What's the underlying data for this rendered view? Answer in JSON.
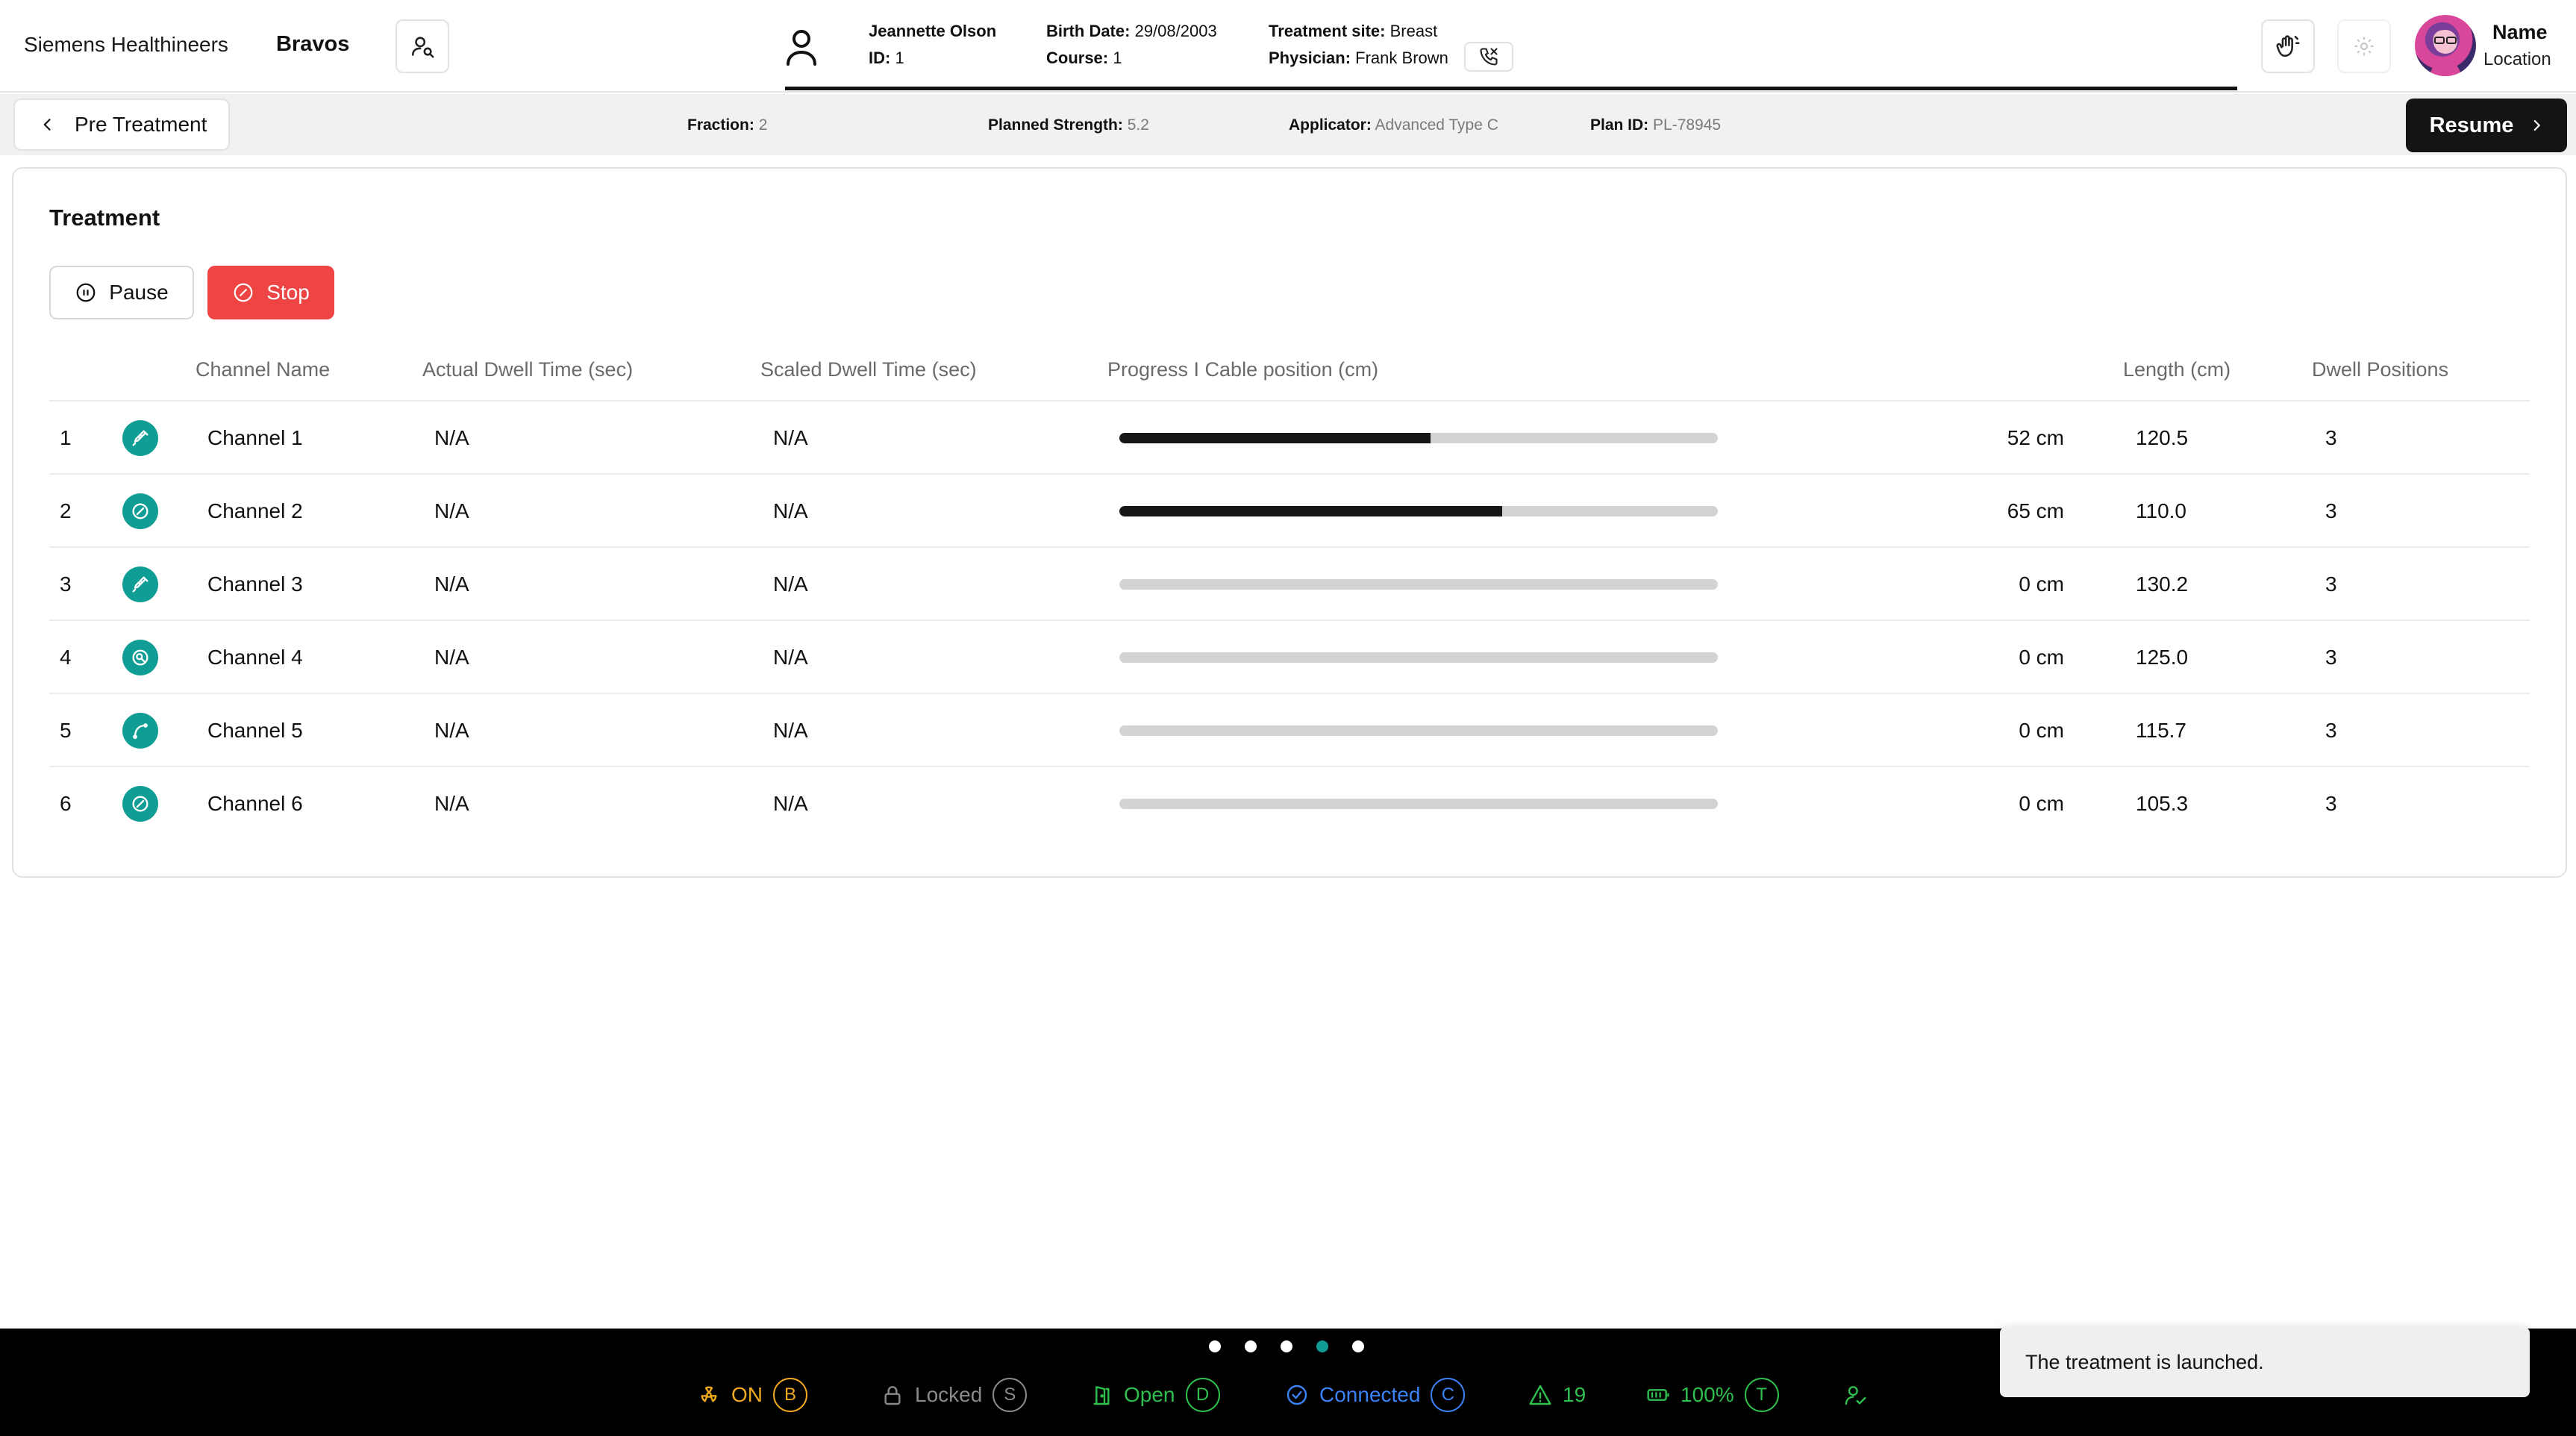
{
  "header": {
    "brand": "Siemens Healthineers",
    "product": "Bravos",
    "patient": {
      "name": "Jeannette Olson",
      "id_label": "ID:",
      "id_value": "1",
      "birth_label": "Birth Date:",
      "birth_value": "29/08/2003",
      "course_label": "Course:",
      "course_value": "1",
      "site_label": "Treatment site:",
      "site_value": "Breast",
      "physician_label": "Physician:",
      "physician_value": "Frank Brown"
    },
    "user": {
      "name": "Name",
      "location": "Location"
    }
  },
  "subbar": {
    "back_label": "Pre Treatment",
    "fraction_label": "Fraction:",
    "fraction_value": "2",
    "strength_label": "Planned Strength:",
    "strength_value": "5.2",
    "applicator_label": "Applicator:",
    "applicator_value": "Advanced Type C",
    "plan_label": "Plan ID:",
    "plan_value": "PL-78945",
    "resume_label": "Resume"
  },
  "treatment": {
    "title": "Treatment",
    "pause_label": "Pause",
    "stop_label": "Stop",
    "columns": [
      "Channel Name",
      "Actual Dwell Time (sec)",
      "Scaled Dwell Time (sec)",
      "Progress I Cable position (cm)",
      "Length (cm)",
      "Dwell Positions"
    ],
    "rows": [
      {
        "num": "1",
        "icon": "syringe-icon",
        "name": "Channel 1",
        "actual": "N/A",
        "scaled": "N/A",
        "progress": 0.52,
        "position": "52 cm",
        "length": "120.5",
        "dwell": "3"
      },
      {
        "num": "2",
        "icon": "blocked-circle-icon",
        "name": "Channel 2",
        "actual": "N/A",
        "scaled": "N/A",
        "progress": 0.64,
        "position": "65 cm",
        "length": "110.0",
        "dwell": "3"
      },
      {
        "num": "3",
        "icon": "syringe-icon",
        "name": "Channel 3",
        "actual": "N/A",
        "scaled": "N/A",
        "progress": 0,
        "position": "0 cm",
        "length": "130.2",
        "dwell": "3"
      },
      {
        "num": "4",
        "icon": "target-icon",
        "name": "Channel 4",
        "actual": "N/A",
        "scaled": "N/A",
        "progress": 0,
        "position": "0 cm",
        "length": "125.0",
        "dwell": "3"
      },
      {
        "num": "5",
        "icon": "curve-icon",
        "name": "Channel 5",
        "actual": "N/A",
        "scaled": "N/A",
        "progress": 0,
        "position": "0 cm",
        "length": "115.7",
        "dwell": "3"
      },
      {
        "num": "6",
        "icon": "blocked-circle-icon",
        "name": "Channel 6",
        "actual": "N/A",
        "scaled": "N/A",
        "progress": 0,
        "position": "0 cm",
        "length": "105.3",
        "dwell": "3"
      }
    ]
  },
  "footer": {
    "pager_active_index": 3,
    "status": [
      {
        "icon": "radiation-icon",
        "label": "ON",
        "key": "B",
        "color": "#f0a81e"
      },
      {
        "icon": "lock-icon",
        "label": "Locked",
        "key": "S",
        "color": "#8a8a8a"
      },
      {
        "icon": "door-icon",
        "label": "Open",
        "key": "D",
        "color": "#2fbf4f"
      },
      {
        "icon": "connected-icon",
        "label": "Connected",
        "key": "C",
        "color": "#3b82f6"
      },
      {
        "icon": "warning-icon",
        "label": "19",
        "key": "",
        "color": "#2fbf4f"
      },
      {
        "icon": "battery-icon",
        "label": "100%",
        "key": "T",
        "color": "#2fbf4f"
      },
      {
        "icon": "user-check-icon",
        "label": "",
        "key": "",
        "color": "#2fbf4f"
      }
    ],
    "colors": {
      "dot": "#ffffff",
      "dot_active": "#0f9d95"
    }
  },
  "toast": {
    "message": "The treatment is launched."
  }
}
